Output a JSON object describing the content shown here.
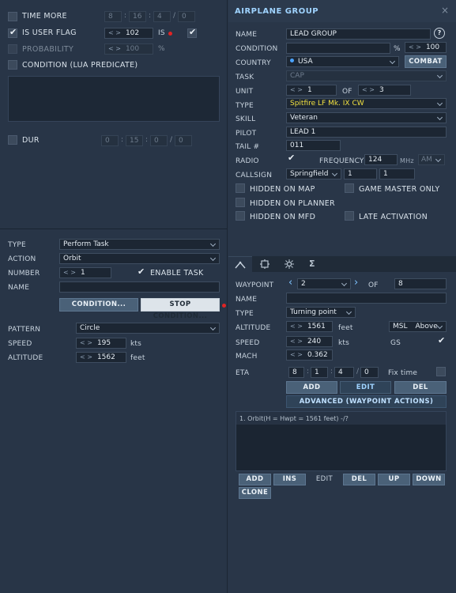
{
  "trigger": {
    "time_more": {
      "label": "TIME MORE",
      "values": [
        "8",
        "16",
        "4",
        "0"
      ]
    },
    "user_flag": {
      "label": "IS USER FLAG",
      "value": "102",
      "is_label": "IS"
    },
    "probability": {
      "label": "PROBABILITY",
      "value": "100",
      "unit": "%"
    },
    "condition": {
      "label": "CONDITION (LUA PREDICATE)"
    },
    "dur": {
      "label": "DUR",
      "values": [
        "0",
        "15",
        "0",
        "0"
      ]
    }
  },
  "task": {
    "type_label": "TYPE",
    "type_value": "Perform Task",
    "action_label": "ACTION",
    "action_value": "Orbit",
    "number_label": "NUMBER",
    "number_value": "1",
    "enable_label": "ENABLE TASK",
    "name_label": "NAME",
    "name_value": "",
    "condition_btn": "CONDITION...",
    "stop_condition_btn": "STOP CONDITION...",
    "pattern_label": "PATTERN",
    "pattern_value": "Circle",
    "speed_label": "SPEED",
    "speed_value": "195",
    "speed_unit": "kts",
    "altitude_label": "ALTITUDE",
    "altitude_value": "1562",
    "altitude_unit": "feet"
  },
  "group": {
    "title": "AIRPLANE GROUP",
    "close": "×",
    "name_label": "NAME",
    "name_value": "LEAD GROUP",
    "help": "?",
    "condition_label": "CONDITION",
    "condition_pct": "%",
    "condition_value": "100",
    "country_label": "COUNTRY",
    "country_value": "USA",
    "combat_btn": "COMBAT",
    "task_label": "TASK",
    "task_value": "CAP",
    "unit_label": "UNIT",
    "unit_value": "1",
    "of_label": "OF",
    "unit_total": "3",
    "type_label": "TYPE",
    "type_value": "Spitfire LF Mk. IX CW",
    "skill_label": "SKILL",
    "skill_value": "Veteran",
    "pilot_label": "PILOT",
    "pilot_value": "LEAD 1",
    "tail_label": "TAIL #",
    "tail_value": "011",
    "radio_label": "RADIO",
    "frequency_label": "FREQUENCY",
    "frequency_value": "124",
    "mhz": "MHz",
    "modulation": "AM",
    "callsign_label": "CALLSIGN",
    "callsign_value": "Springfield",
    "callsign_n1": "1",
    "callsign_n2": "1",
    "hidden_map": "HIDDEN ON MAP",
    "game_master": "GAME MASTER ONLY",
    "hidden_planner": "HIDDEN ON PLANNER",
    "hidden_mfd": "HIDDEN ON MFD",
    "late_activation": "LATE ACTIVATION"
  },
  "tabs": [
    {
      "icon": "route-icon"
    },
    {
      "icon": "target-icon"
    },
    {
      "icon": "settings-icon"
    },
    {
      "icon": "sigma-icon",
      "glyph": "Σ"
    }
  ],
  "waypoint": {
    "waypoint_label": "WAYPOINT",
    "waypoint_value": "2",
    "of_label": "OF",
    "total": "8",
    "name_label": "NAME",
    "name_value": "",
    "type_label": "TYPE",
    "type_value": "Turning point",
    "altitude_label": "ALTITUDE",
    "altitude_value": "1561",
    "altitude_unit": "feet",
    "alt_ref": "MSL",
    "alt_mode": "Above",
    "speed_label": "SPEED",
    "speed_value": "240",
    "speed_unit": "kts",
    "gs_label": "GS",
    "mach_label": "MACH",
    "mach_value": "0.362",
    "eta_label": "ETA",
    "eta_values": [
      "8",
      "1",
      "4",
      "0"
    ],
    "fix_time_label": "Fix time",
    "add_btn": "ADD",
    "edit_btn": "EDIT",
    "del_btn": "DEL",
    "advanced_btn": "ADVANCED (WAYPOINT ACTIONS)",
    "actions": [
      "1. Orbit(H = Hwpt = 1561 feet)  -/?"
    ],
    "list_buttons": [
      "ADD",
      "INS",
      "EDIT",
      "DEL",
      "UP",
      "DOWN"
    ],
    "clone_btn": "CLONE"
  },
  "colors": {
    "background": "#283547",
    "accent": "#4a6178",
    "highlight_text": "#f0e040",
    "flag_dot": "#e02424"
  }
}
